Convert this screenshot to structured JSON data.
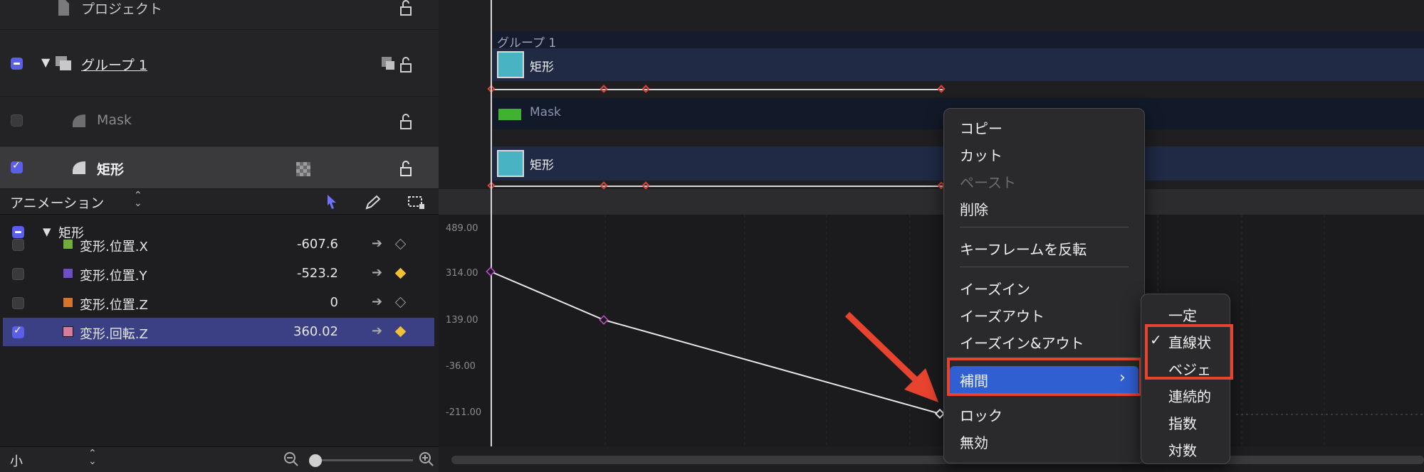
{
  "layers": {
    "project_label": "プロジェクト",
    "group_label": "グループ 1",
    "mask_label": "Mask",
    "shape_label": "矩形"
  },
  "timeline": {
    "group_title": "グループ 1",
    "track1_label": "矩形",
    "mask_label": "Mask",
    "track2_label": "矩形"
  },
  "animation": {
    "header_label": "アニメーション",
    "group_label": "矩形",
    "params": [
      {
        "name": "変形.位置.X",
        "value": "-607.6",
        "color": "#6fae3c",
        "keyed": false
      },
      {
        "name": "変形.位置.Y",
        "value": "-523.2",
        "color": "#6a4fc6",
        "keyed": true
      },
      {
        "name": "変形.位置.Z",
        "value": "0",
        "color": "#d6742a",
        "keyed": false
      },
      {
        "name": "変形.回転.Z",
        "value": "360.02",
        "color": "#d57d9c",
        "keyed": true
      }
    ]
  },
  "graph": {
    "y_ticks": [
      "489.00",
      "314.00",
      "139.00",
      "-36.00",
      "-211.00"
    ]
  },
  "bottom": {
    "size_label": "小"
  },
  "context_menu": {
    "items": [
      "コピー",
      "カット",
      "ペースト",
      "削除",
      "キーフレームを反転",
      "イーズイン",
      "イーズアウト",
      "イーズイン&アウト",
      "補間",
      "ロック",
      "無効"
    ]
  },
  "submenu": {
    "items": [
      "一定",
      "直線状",
      "ベジェ",
      "連続的",
      "指数",
      "対数"
    ],
    "checked": "直線状"
  },
  "colors": {
    "accent": "#5a5ee8",
    "highlight": "#e8432f",
    "menu_selected": "#2f5fd0",
    "keyframe": "#e0453c"
  }
}
